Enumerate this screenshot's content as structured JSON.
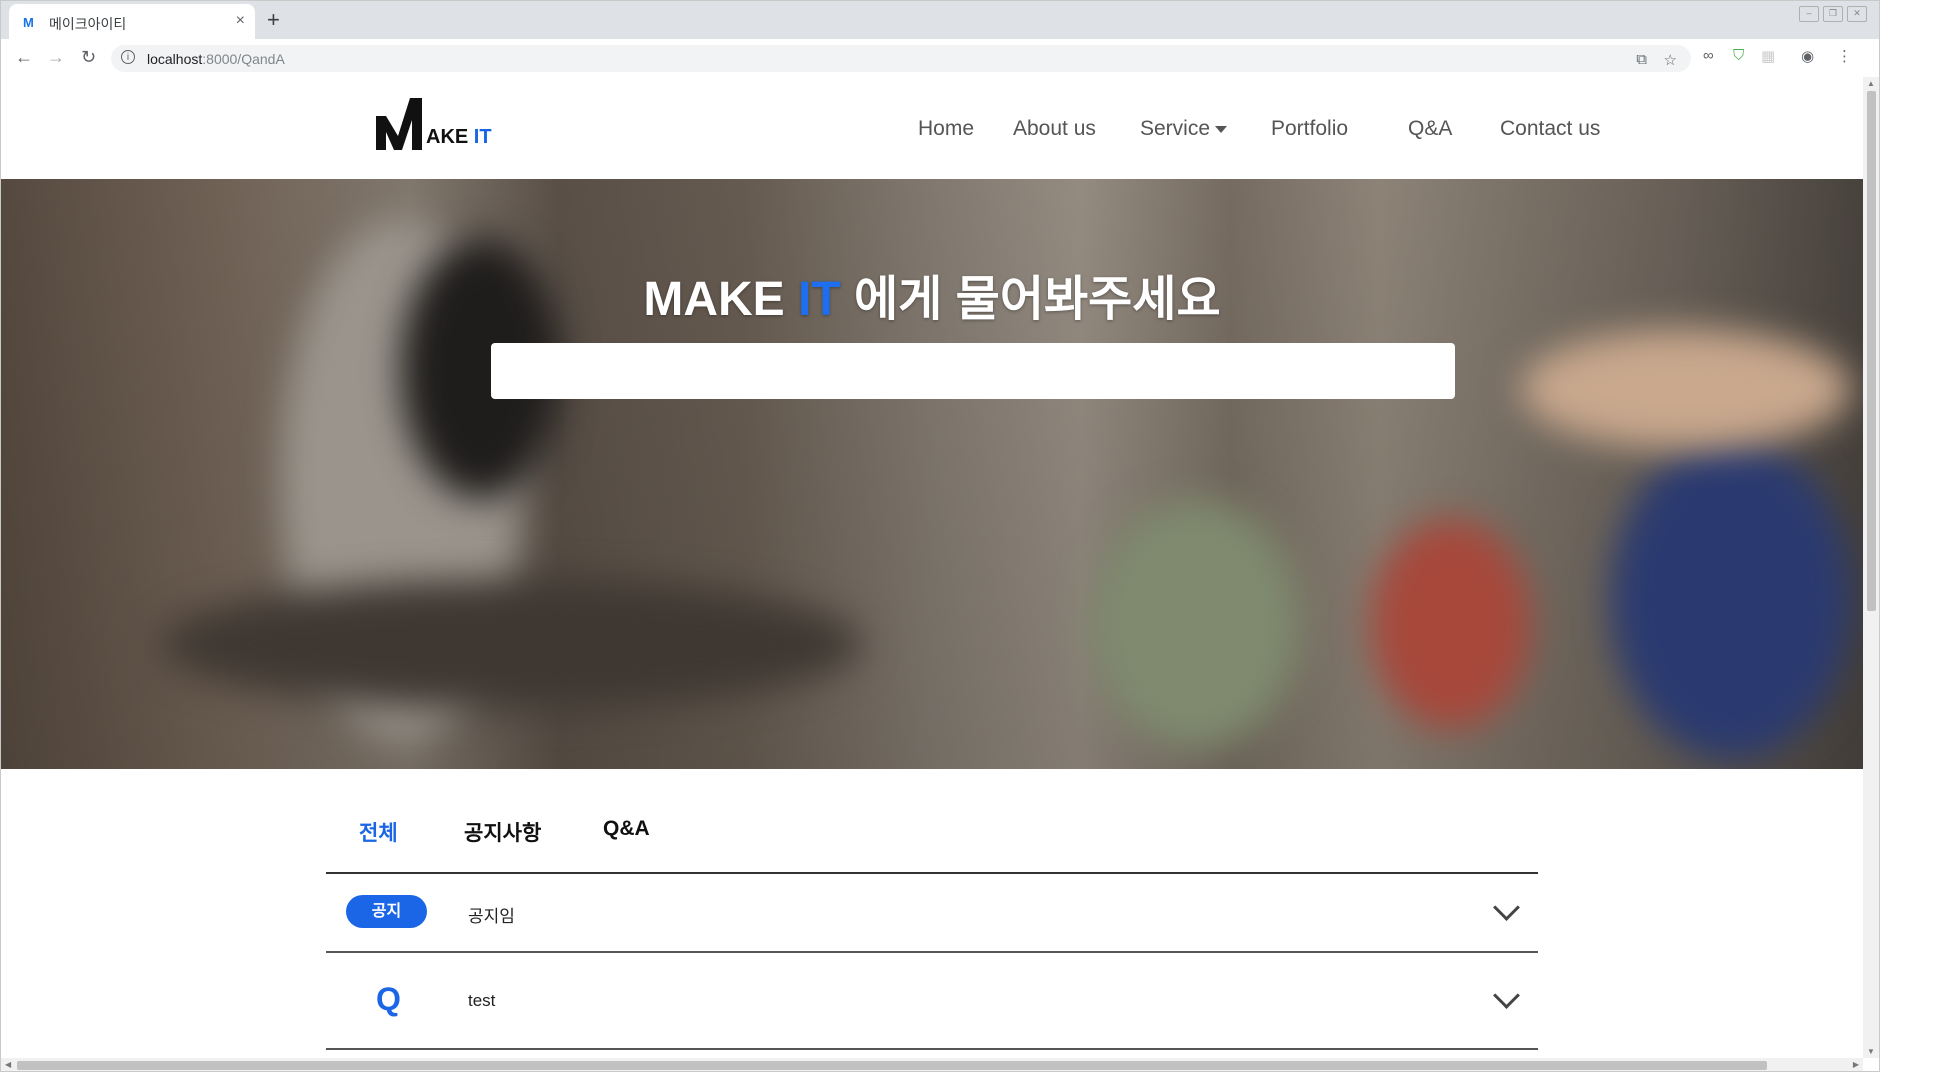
{
  "browser": {
    "tab_title": "메이크아이티",
    "favicon": "M",
    "tab_close": "×",
    "new_tab": "+",
    "url_host": "localhost",
    "url_rest": ":8000/QandA",
    "back_icon": "←",
    "forward_icon": "→",
    "reload_icon": "↻",
    "info_icon": "i"
  },
  "site": {
    "logo_text": "AKE",
    "logo_accent": "IT",
    "nav": [
      "Home",
      "About us",
      "Service",
      "Portfolio",
      "Q&A",
      "Contact us"
    ]
  },
  "hero": {
    "title_prefix": "MAKE",
    "title_accent": "IT",
    "title_suffix": "에게 물어봐주세요",
    "search_value": ""
  },
  "board": {
    "tabs": [
      "전체",
      "공지사항",
      "Q&A"
    ],
    "active_tab": 0,
    "rows": [
      {
        "type": "notice",
        "badge": "공지",
        "text": "공지임"
      },
      {
        "type": "question",
        "mark": "Q",
        "text": "test"
      }
    ]
  },
  "colors": {
    "accent": "#1a66e6",
    "nav_text": "#555555"
  }
}
